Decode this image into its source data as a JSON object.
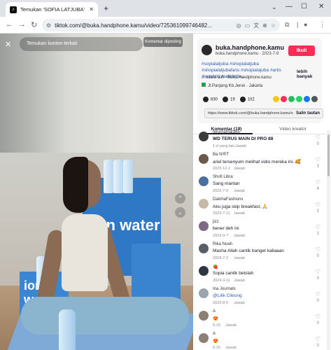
{
  "browser": {
    "tab_title": "Temukan 'SOFIA LATJUBA' di TikTok",
    "tab_favicon": "tiktok-icon",
    "url": "tiktok.com/@buka.handphone.kamu/video/725361099746482...",
    "new_tab": "+",
    "win_minimize": "—",
    "win_maximize": "☐",
    "win_close": "✕"
  },
  "video": {
    "search_placeholder": "Temukan konten terkait",
    "report_label": "Komentar diposting",
    "brand_text_1": "ion water",
    "brand_text_2": "ion water"
  },
  "post": {
    "username": "buka.handphone.kamu",
    "subline": "buka.handphone.kamu · 2023-7-9",
    "follow_label": "Ikuti",
    "description": "#sopialatjuba #shopialatjuba #shopialatjubafans #shopialajuba #artis #selebriti #selebritis...",
    "more_label": "lebih banyak",
    "music": "♫ suara asli - Buka.Handphone.kamu",
    "location": "Jl.Panjang Kb.Jeruk · Jakarta",
    "likes": "830",
    "comments_count": "19",
    "saves": "102",
    "link": "https://www.tiktok.com/@buka.handphone.kamu/v...",
    "copy_label": "Salin tautan"
  },
  "tabs": {
    "comments": "Komentar (19)",
    "creator": "Video kreator"
  },
  "comments": [
    {
      "name": "ferumamat165",
      "text": "WD TERUS MAIN DI PRO 88",
      "date": "1-d yang lalu",
      "reply": "Jawab",
      "likes": "0",
      "bold": true
    },
    {
      "name": "Ba N!®T",
      "text": "ariel tersenyum melihat vidio mereka ini..🥰",
      "date": "2023-12-2",
      "reply": "Jawab",
      "likes": "3"
    },
    {
      "name": "Shofi Libra",
      "text": "Sang mantan",
      "date": "2023-7-9",
      "reply": "Jawab",
      "likes": "4"
    },
    {
      "name": "DalohaFashions",
      "text": "Aku juga skip breakfast, 🙏",
      "date": "2023-7-11",
      "reply": "Jawab",
      "likes": "2"
    },
    {
      "name": "jizz",
      "text": "bener deh ini",
      "date": "2023-9-7",
      "reply": "Jawab",
      "likes": "1"
    },
    {
      "name": "Rika Noah",
      "text": "Masha Allah cantik banget kaliaaan",
      "date": "2024-7-2",
      "reply": "Jawab",
      "likes": "0"
    },
    {
      "name": "🍓",
      "text": "Sopia cantik betslah",
      "date": "2024-3-11",
      "reply": "Jawab",
      "likes": "0"
    },
    {
      "name": "Ina Journals",
      "text": "@Lilik Cileung",
      "date": "2023-8-5",
      "reply": "Jawab",
      "likes": "0",
      "mention": true
    },
    {
      "name": "A",
      "text": "😍",
      "date": "5-15",
      "reply": "Jawab",
      "likes": "0"
    },
    {
      "name": "A",
      "text": "😍",
      "date": "5-15",
      "reply": "Jawab",
      "likes": "0"
    }
  ],
  "colors": {
    "follow": "#fe2c55",
    "link_blue": "#2b5db4"
  }
}
